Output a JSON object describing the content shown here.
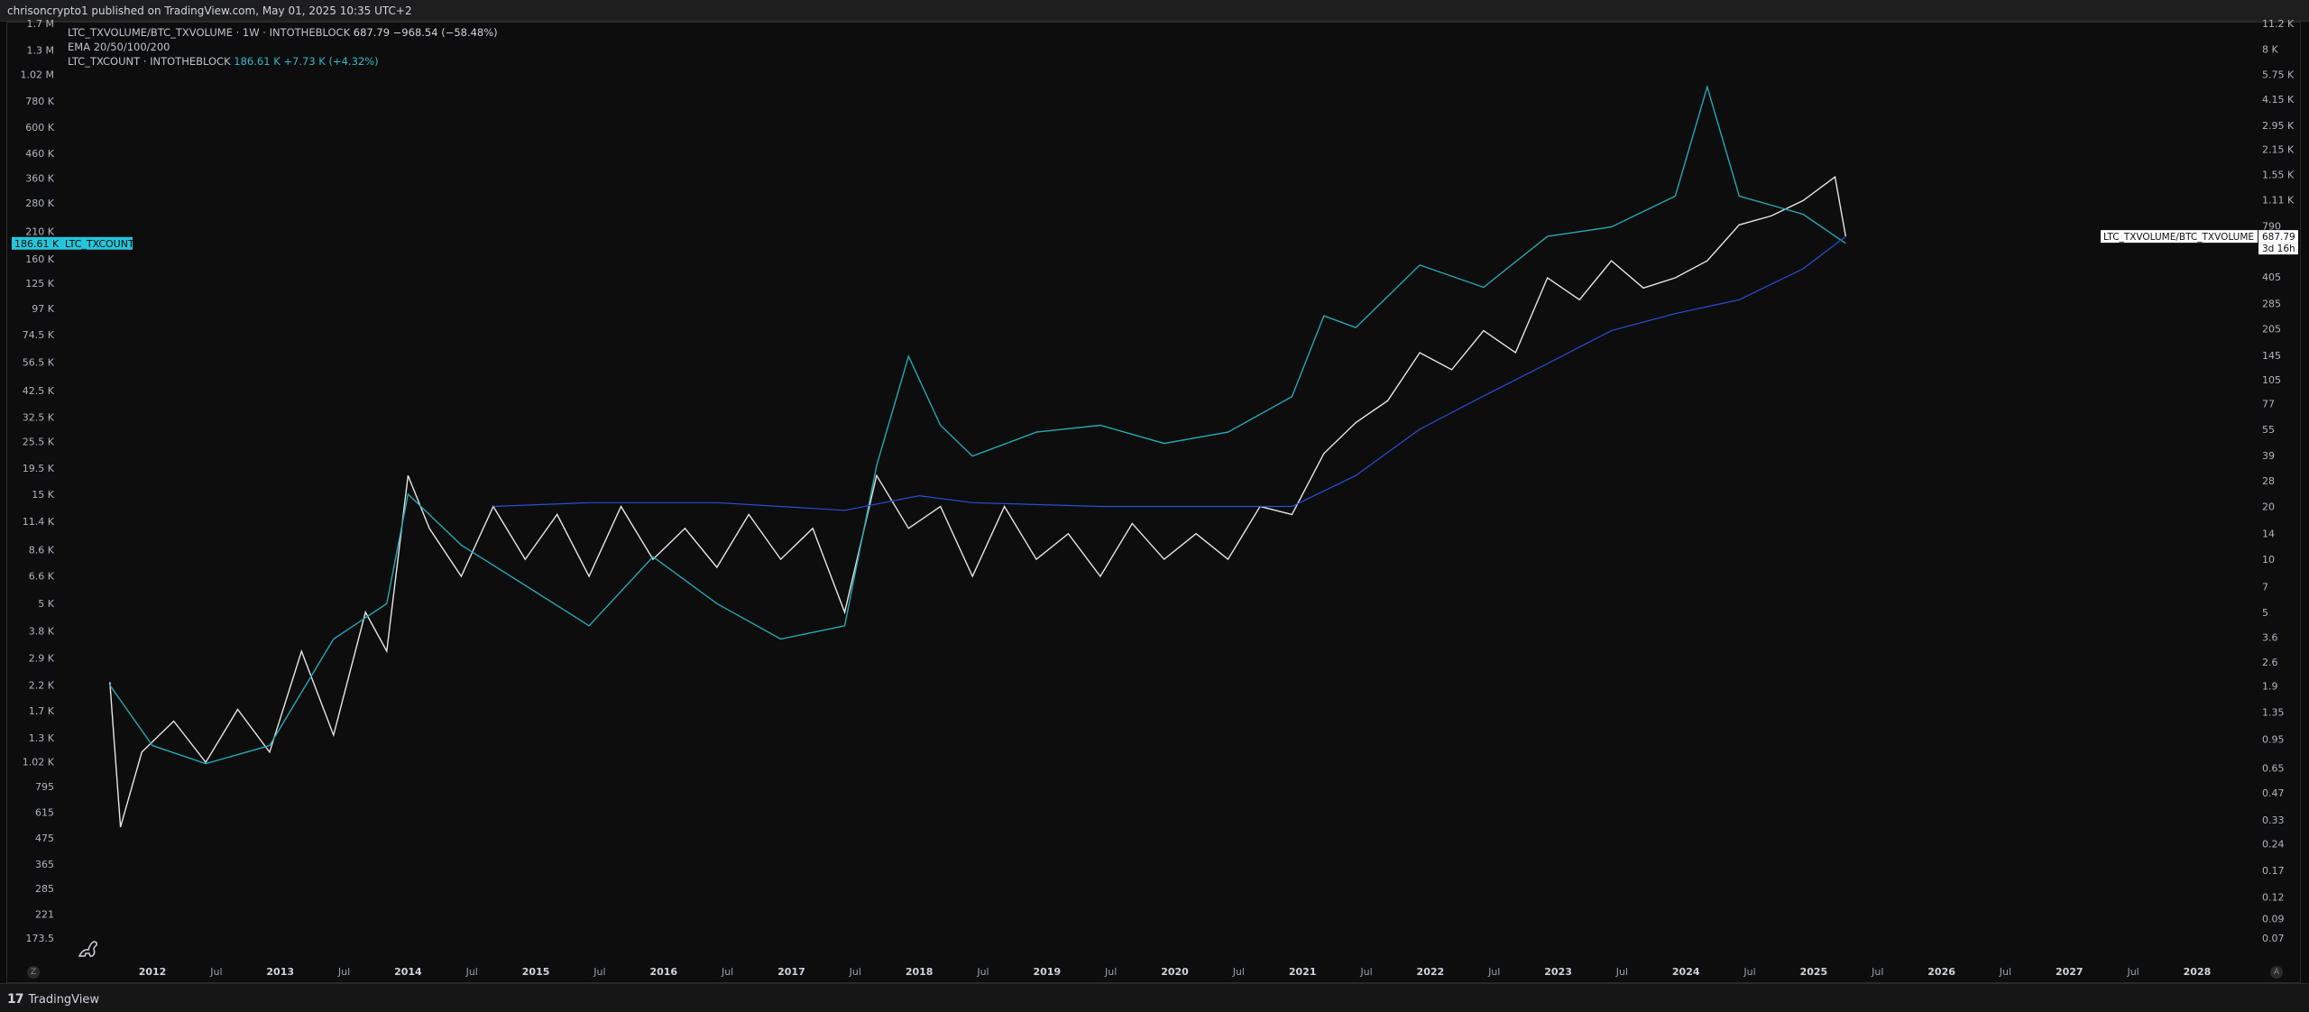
{
  "header": {
    "published_text": "chrisoncrypto1 published on TradingView.com, May 01, 2025 10:35 UTC+2"
  },
  "footer": {
    "brand": "TradingView",
    "logo_mark": "17"
  },
  "legend": {
    "main_symbol": "LTC_TXVOLUME/BTC_TXVOLUME · 1W · INTOTHEBLOCK",
    "main_value": "687.79",
    "main_change": "−968.54 (−58.48%)",
    "ema": "EMA 20/50/100/200",
    "overlay_symbol": "LTC_TXCOUNT · INTOTHEBLOCK",
    "overlay_value": "186.61 K",
    "overlay_change": "+7.73 K (+4.32%)"
  },
  "left_badge": {
    "value": "186.61 K",
    "label": "LTC_TXCOUNT"
  },
  "right_badge": {
    "label": "LTC_TXVOLUME/BTC_TXVOLUME",
    "value": "687.79",
    "countdown": "3d 16h"
  },
  "buttons": {
    "left_small": "Z",
    "right_small": "A"
  },
  "colors": {
    "background": "#0d0d0d",
    "ratio_line": "#e6e6e6",
    "txcount_line": "#26a7b5",
    "ema_line": "#2a4fd6",
    "badge_teal": "#26c6da"
  },
  "chart_data": {
    "type": "line",
    "title": "",
    "x_axis": {
      "tick_labels": [
        "2012",
        "Jul",
        "2013",
        "Jul",
        "2014",
        "Jul",
        "2015",
        "Jul",
        "2016",
        "Jul",
        "2017",
        "Jul",
        "2018",
        "Jul",
        "2019",
        "Jul",
        "2020",
        "Jul",
        "2021",
        "Jul",
        "2022",
        "Jul",
        "2023",
        "Jul",
        "2024",
        "Jul",
        "2025",
        "Jul",
        "2026",
        "Jul",
        "2027",
        "Jul",
        "2028"
      ],
      "range": [
        "2011-08",
        "2028-06"
      ]
    },
    "left_axis": {
      "scale": "log",
      "tick_labels": [
        "1.7 M",
        "1.3 M",
        "1.02 M",
        "780 K",
        "600 K",
        "460 K",
        "360 K",
        "280 K",
        "210 K",
        "160 K",
        "125 K",
        "97 K",
        "74.5 K",
        "56.5 K",
        "42.5 K",
        "32.5 K",
        "25.5 K",
        "19.5 K",
        "15 K",
        "11.4 K",
        "8.6 K",
        "6.6 K",
        "5 K",
        "3.8 K",
        "2.9 K",
        "2.2 K",
        "1.7 K",
        "1.3 K",
        "1.02 K",
        "795",
        "615",
        "475",
        "365",
        "285",
        "221",
        "173.5"
      ]
    },
    "right_axis": {
      "scale": "log",
      "tick_labels": [
        "11.2 K",
        "8 K",
        "5.75 K",
        "4.15 K",
        "2.95 K",
        "2.15 K",
        "1.55 K",
        "1.11 K",
        "790",
        "405",
        "285",
        "205",
        "145",
        "105",
        "77",
        "55",
        "39",
        "28",
        "20",
        "14",
        "10",
        "7",
        "5",
        "3.6",
        "2.6",
        "1.9",
        "1.35",
        "0.95",
        "0.65",
        "0.47",
        "0.33",
        "0.24",
        "0.17",
        "0.12",
        "0.09",
        "0.07"
      ]
    },
    "series": [
      {
        "name": "LTC_TXVOLUME/BTC_TXVOLUME",
        "axis": "right",
        "color": "#e6e6e6",
        "points": [
          [
            "2011-09",
            2.0
          ],
          [
            "2011-10",
            0.3
          ],
          [
            "2011-12",
            0.8
          ],
          [
            "2012-03",
            1.2
          ],
          [
            "2012-06",
            0.7
          ],
          [
            "2012-09",
            1.4
          ],
          [
            "2012-12",
            0.8
          ],
          [
            "2013-03",
            3.0
          ],
          [
            "2013-06",
            1.0
          ],
          [
            "2013-09",
            5.0
          ],
          [
            "2013-11",
            3.0
          ],
          [
            "2014-01",
            30
          ],
          [
            "2014-03",
            15
          ],
          [
            "2014-06",
            8
          ],
          [
            "2014-09",
            20
          ],
          [
            "2014-12",
            10
          ],
          [
            "2015-03",
            18
          ],
          [
            "2015-06",
            8
          ],
          [
            "2015-09",
            20
          ],
          [
            "2015-12",
            10
          ],
          [
            "2016-03",
            15
          ],
          [
            "2016-06",
            9
          ],
          [
            "2016-09",
            18
          ],
          [
            "2016-12",
            10
          ],
          [
            "2017-03",
            15
          ],
          [
            "2017-06",
            5
          ],
          [
            "2017-09",
            30
          ],
          [
            "2017-12",
            15
          ],
          [
            "2018-03",
            20
          ],
          [
            "2018-06",
            8
          ],
          [
            "2018-09",
            20
          ],
          [
            "2018-12",
            10
          ],
          [
            "2019-03",
            14
          ],
          [
            "2019-06",
            8
          ],
          [
            "2019-09",
            16
          ],
          [
            "2019-12",
            10
          ],
          [
            "2020-03",
            14
          ],
          [
            "2020-06",
            10
          ],
          [
            "2020-09",
            20
          ],
          [
            "2020-12",
            18
          ],
          [
            "2021-03",
            40
          ],
          [
            "2021-06",
            60
          ],
          [
            "2021-09",
            80
          ],
          [
            "2021-12",
            150
          ],
          [
            "2022-03",
            120
          ],
          [
            "2022-06",
            200
          ],
          [
            "2022-09",
            150
          ],
          [
            "2022-12",
            400
          ],
          [
            "2023-03",
            300
          ],
          [
            "2023-06",
            500
          ],
          [
            "2023-09",
            350
          ],
          [
            "2023-12",
            400
          ],
          [
            "2024-03",
            500
          ],
          [
            "2024-06",
            800
          ],
          [
            "2024-09",
            900
          ],
          [
            "2024-12",
            1100
          ],
          [
            "2025-03",
            1500
          ],
          [
            "2025-04",
            687.79
          ]
        ]
      },
      {
        "name": "LTC_TXCOUNT",
        "axis": "left",
        "color": "#26a7b5",
        "points": [
          [
            "2011-09",
            2200
          ],
          [
            "2012-01",
            1200
          ],
          [
            "2012-06",
            1000
          ],
          [
            "2012-12",
            1200
          ],
          [
            "2013-06",
            3500
          ],
          [
            "2013-11",
            5000
          ],
          [
            "2014-01",
            15000
          ],
          [
            "2014-06",
            9000
          ],
          [
            "2014-12",
            6000
          ],
          [
            "2015-06",
            4000
          ],
          [
            "2015-12",
            8000
          ],
          [
            "2016-06",
            5000
          ],
          [
            "2016-12",
            3500
          ],
          [
            "2017-06",
            4000
          ],
          [
            "2017-09",
            20000
          ],
          [
            "2017-12",
            60000
          ],
          [
            "2018-03",
            30000
          ],
          [
            "2018-06",
            22000
          ],
          [
            "2018-12",
            28000
          ],
          [
            "2019-06",
            30000
          ],
          [
            "2019-12",
            25000
          ],
          [
            "2020-06",
            28000
          ],
          [
            "2020-12",
            40000
          ],
          [
            "2021-03",
            90000
          ],
          [
            "2021-06",
            80000
          ],
          [
            "2021-12",
            150000
          ],
          [
            "2022-06",
            120000
          ],
          [
            "2022-12",
            200000
          ],
          [
            "2023-06",
            220000
          ],
          [
            "2023-12",
            300000
          ],
          [
            "2024-03",
            900000
          ],
          [
            "2024-06",
            300000
          ],
          [
            "2024-12",
            250000
          ],
          [
            "2025-04",
            186610
          ]
        ]
      },
      {
        "name": "EMA",
        "axis": "right",
        "color": "#2a4fd6",
        "points": [
          [
            "2014-09",
            20
          ],
          [
            "2015-06",
            21
          ],
          [
            "2016-06",
            21
          ],
          [
            "2017-06",
            19
          ],
          [
            "2018-01",
            23
          ],
          [
            "2018-06",
            21
          ],
          [
            "2019-06",
            20
          ],
          [
            "2020-06",
            20
          ],
          [
            "2020-12",
            20
          ],
          [
            "2021-06",
            30
          ],
          [
            "2021-12",
            55
          ],
          [
            "2022-06",
            85
          ],
          [
            "2022-12",
            130
          ],
          [
            "2023-06",
            200
          ],
          [
            "2023-12",
            250
          ],
          [
            "2024-06",
            300
          ],
          [
            "2024-12",
            450
          ],
          [
            "2025-04",
            687.79
          ]
        ]
      }
    ]
  }
}
